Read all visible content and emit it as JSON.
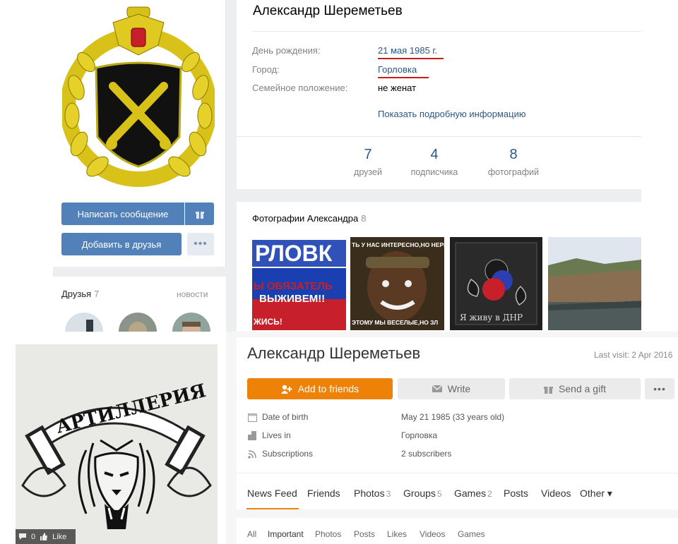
{
  "vk": {
    "name": "Александр Шереметьев",
    "buttons": {
      "message": "Написать сообщение",
      "add_friend": "Добавить в друзья",
      "more": "•••"
    },
    "friends": {
      "title": "Друзья",
      "count": "7",
      "news": "новости"
    },
    "info": {
      "birthday_label": "День рождения:",
      "birthday_value": "21 мая 1985 г.",
      "city_label": "Город:",
      "city_value": "Горловка",
      "family_label": "Семейное положение:",
      "family_value": "не женат",
      "show_more": "Показать подробную информацию"
    },
    "stats": [
      {
        "num": "7",
        "label": "друзей"
      },
      {
        "num": "4",
        "label": "подписчика"
      },
      {
        "num": "8",
        "label": "фотографий"
      }
    ],
    "photos": {
      "title": "Фотографии Александра",
      "count": "8",
      "thumb1_text": [
        "РЛОВК",
        "Ы ОБЯЗАТЕЛЬ",
        "ВЫЖИВЕМ!!",
        "ЖИСЬ!"
      ],
      "thumb2_text": [
        "ТЬ У НАС ИНТЕРЕСНО,НО НЕРВ",
        "ЭТОМУ МЫ ВЕСЕЛЫЕ,НО ЗЛ"
      ],
      "thumb3_text": "Я живу в ДНР"
    },
    "colors": {
      "accent": "#5181b8",
      "link": "#2a5885",
      "underline": "#cc1d1d"
    }
  },
  "ok": {
    "name": "Александр Шереметьев",
    "last_visit": "Last visit: 2 Apr 2016",
    "buttons": {
      "add": "Add to friends",
      "write": "Write",
      "gift": "Send a gift",
      "more": "•••"
    },
    "rows": [
      {
        "icon": "calendar-icon",
        "label": "Date of birth",
        "value": "May 21 1985 (33 years old)"
      },
      {
        "icon": "building-icon",
        "label": "Lives in",
        "value": "Горловка"
      },
      {
        "icon": "rss-icon",
        "label": "Subscriptions",
        "value": "2 subscribers"
      }
    ],
    "tabs": [
      {
        "label": "News Feed",
        "count": ""
      },
      {
        "label": "Friends",
        "count": ""
      },
      {
        "label": "Photos",
        "count": "3"
      },
      {
        "label": "Groups",
        "count": "5"
      },
      {
        "label": "Games",
        "count": "2"
      },
      {
        "label": "Posts",
        "count": ""
      },
      {
        "label": "Videos",
        "count": ""
      },
      {
        "label": "Other ▾",
        "count": ""
      }
    ],
    "filters": [
      "All",
      "Important",
      "Photos",
      "Posts",
      "Likes",
      "Videos",
      "Games"
    ],
    "photo_bar": {
      "comments": "0",
      "like_label": "Like"
    },
    "drawing_text": "АРТИЛЛЕРИЯ",
    "colors": {
      "accent": "#ee8208"
    }
  }
}
